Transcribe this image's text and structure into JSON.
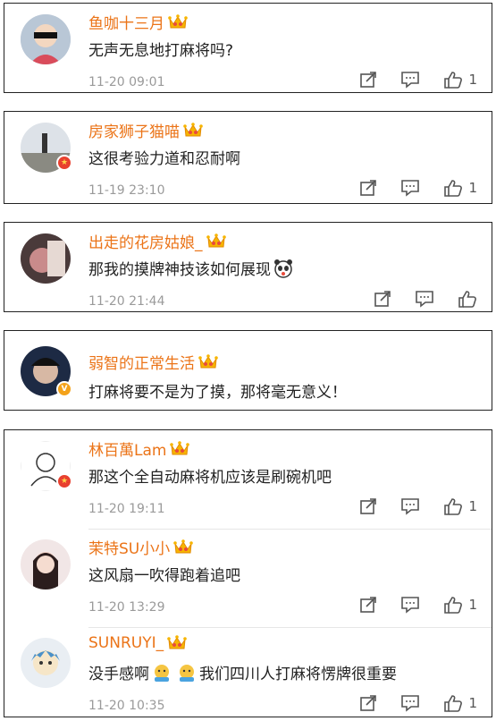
{
  "comments": [
    {
      "username": "鱼咖十三月",
      "text": "无声无息地打麻将吗?",
      "time": "11-20 09:01",
      "likes": "1"
    },
    {
      "username": "房家狮子猫喵",
      "text": "这很考验力道和忍耐啊",
      "time": "11-19 23:10",
      "likes": "1"
    },
    {
      "username": "出走的花房姑娘_",
      "text": "那我的摸牌神技该如何展现",
      "time": "11-20 21:44",
      "likes": ""
    },
    {
      "username": "弱智的正常生活",
      "text": "打麻将要不是为了摸，那将毫无意义！",
      "time": "",
      "likes": ""
    },
    {
      "username": "林百萬Lam",
      "text": "那这个全自动麻将机应该是刷碗机吧",
      "time": "11-20 19:11",
      "likes": "1"
    },
    {
      "username": "茉特SU小小",
      "text": "这风扇一吹得跑着追吧",
      "time": "11-20 13:29",
      "likes": "1"
    },
    {
      "username": "SUNRUYI_",
      "text_a": "没手感啊",
      "text_b": "我们四川人打麻将愣牌很重要",
      "time": "11-20 10:35",
      "likes": "1"
    }
  ],
  "icons": {
    "crown": "crown-icon",
    "share": "share-icon",
    "comment": "comment-icon",
    "like": "thumbs-up-icon",
    "badge": "verified-badge-icon"
  },
  "colors": {
    "username": "#eb7418",
    "time": "#9a9a9a",
    "badge_red": "#e8402f",
    "badge_gold": "#f4a21a"
  }
}
